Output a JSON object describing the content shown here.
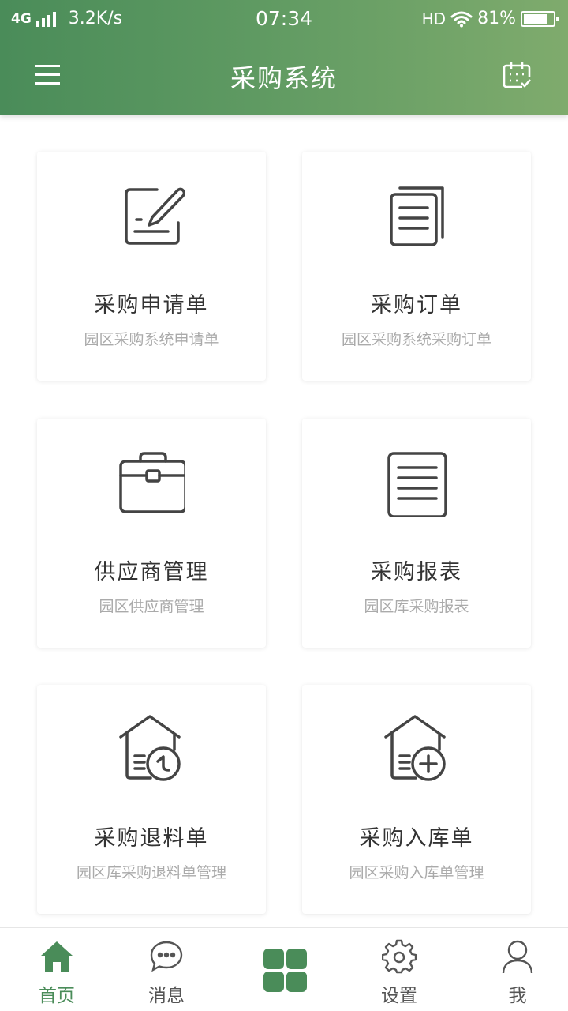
{
  "status_bar": {
    "network": "4G",
    "speed": "3.2K/s",
    "time": "07:34",
    "hd": "HD",
    "battery": "81%",
    "battery_level": 0.81
  },
  "header": {
    "title": "采购系统",
    "menu_icon": "menu-icon",
    "calendar_icon": "calendar-icon"
  },
  "cards": [
    {
      "title": "采购申请单",
      "subtitle": "园区采购系统申请单",
      "icon": "edit-form-icon"
    },
    {
      "title": "采购订单",
      "subtitle": "园区采购系统采购订单",
      "icon": "document-stack-icon"
    },
    {
      "title": "供应商管理",
      "subtitle": "园区供应商管理",
      "icon": "briefcase-icon"
    },
    {
      "title": "采购报表",
      "subtitle": "园区库采购报表",
      "icon": "report-icon"
    },
    {
      "title": "采购退料单",
      "subtitle": "园区库采购退料单管理",
      "icon": "warehouse-return-icon"
    },
    {
      "title": "采购入库单",
      "subtitle": "园区采购入库单管理",
      "icon": "warehouse-add-icon"
    }
  ],
  "tabbar": {
    "items": [
      {
        "label": "首页",
        "icon": "home-icon",
        "active": true
      },
      {
        "label": "消息",
        "icon": "chat-icon",
        "active": false
      },
      {
        "label": "",
        "icon": "grid-icon",
        "active": false
      },
      {
        "label": "设置",
        "icon": "gear-icon",
        "active": false
      },
      {
        "label": "我",
        "icon": "user-icon",
        "active": false
      }
    ]
  },
  "colors": {
    "primary": "#4a8c59",
    "header_end": "#7fab6d",
    "title_text": "#333333",
    "subtitle_text": "#aaaaaa",
    "icon_stroke": "#444444"
  }
}
